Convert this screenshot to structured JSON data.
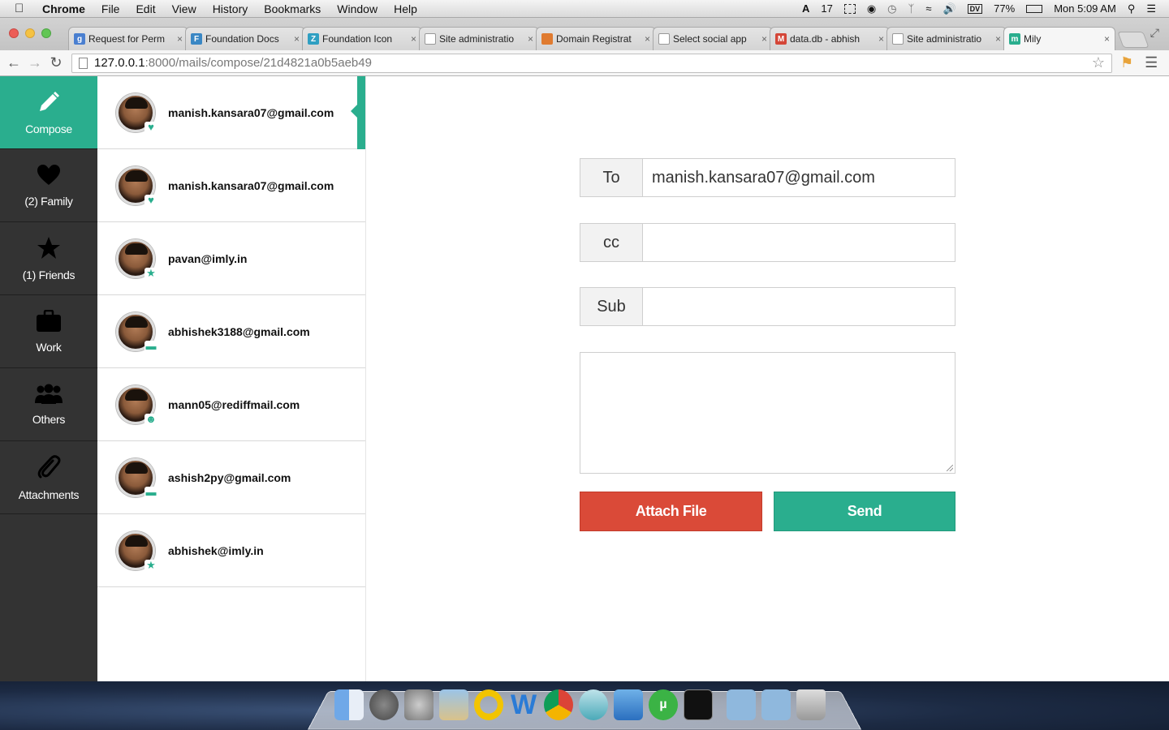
{
  "menubar": {
    "app_name": "Chrome",
    "items": [
      "File",
      "Edit",
      "View",
      "History",
      "Bookmarks",
      "Window",
      "Help"
    ],
    "status": {
      "adobe_count": "17",
      "battery": "77%",
      "clock": "Mon 5:09 AM"
    }
  },
  "browser": {
    "tabs": [
      {
        "title": "Request for Perm",
        "favicon_color": "#4a7fd0",
        "favicon_glyph": "g"
      },
      {
        "title": "Foundation Docs",
        "favicon_color": "#3a87c4",
        "favicon_glyph": "F"
      },
      {
        "title": "Foundation Icon",
        "favicon_color": "#2f9fc2",
        "favicon_glyph": "Z"
      },
      {
        "title": "Site administratio",
        "favicon_color": "#ffffff",
        "favicon_glyph": ""
      },
      {
        "title": "Domain Registrat",
        "favicon_color": "#e07b30",
        "favicon_glyph": ""
      },
      {
        "title": "Select social app",
        "favicon_color": "#ffffff",
        "favicon_glyph": ""
      },
      {
        "title": "data.db - abhish",
        "favicon_color": "#d44638",
        "favicon_glyph": "M"
      },
      {
        "title": "Site administratio",
        "favicon_color": "#ffffff",
        "favicon_glyph": ""
      },
      {
        "title": "Mily",
        "favicon_color": "#2aae8e",
        "favicon_glyph": "m"
      }
    ],
    "url_host": "127.0.0.1",
    "url_path": ":8000/mails/compose/21d4821a0b5aeb49"
  },
  "sidenav": [
    {
      "label": "Compose",
      "icon": "pencil-icon",
      "active": true
    },
    {
      "label": "(2) Family",
      "icon": "heart-icon"
    },
    {
      "label": "(1) Friends",
      "icon": "star-icon"
    },
    {
      "label": "Work",
      "icon": "briefcase-icon"
    },
    {
      "label": "Others",
      "icon": "group-icon"
    },
    {
      "label": "Attachments",
      "icon": "paperclip-icon"
    }
  ],
  "contacts": [
    {
      "email": "manish.kansara07@gmail.com",
      "badge": "heart",
      "selected": true
    },
    {
      "email": "manish.kansara07@gmail.com",
      "badge": "heart"
    },
    {
      "email": "pavan@imly.in",
      "badge": "star"
    },
    {
      "email": "abhishek3188@gmail.com",
      "badge": "briefcase"
    },
    {
      "email": "mann05@rediffmail.com",
      "badge": "group"
    },
    {
      "email": "ashish2py@gmail.com",
      "badge": "briefcase"
    },
    {
      "email": "abhishek@imly.in",
      "badge": "star"
    }
  ],
  "compose": {
    "to_label": "To",
    "to_value": "manish.kansara07@gmail.com",
    "cc_label": "cc",
    "cc_value": "",
    "sub_label": "Sub",
    "sub_value": "",
    "body_value": "",
    "attach_button": "Attach File",
    "send_button": "Send"
  },
  "colors": {
    "accent": "#2aae8e",
    "danger": "#da4a38",
    "sidebar": "#333333"
  }
}
